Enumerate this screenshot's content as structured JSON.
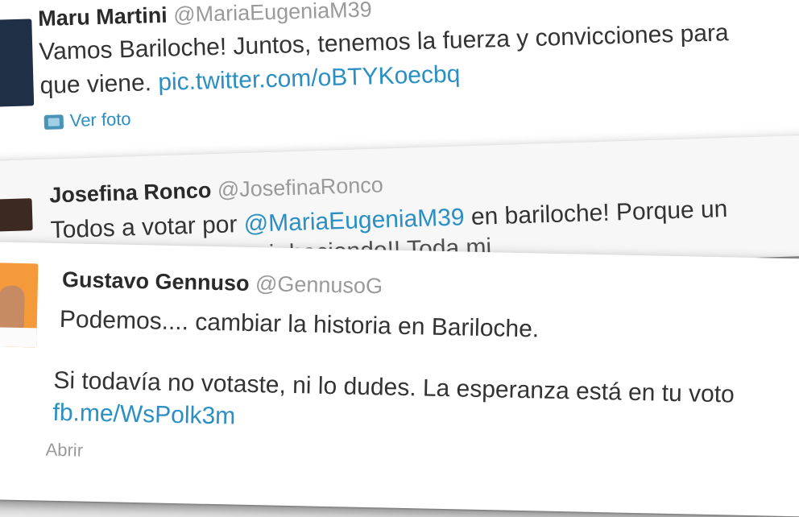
{
  "tweets": [
    {
      "name": "Maru Martini",
      "handle": "@MariaEugeniaM39",
      "line1": "Vamos Bariloche! Juntos, tenemos la fuerza y convicciones para",
      "line2_text": "que viene.",
      "line2_link": "pic.twitter.com/oBTYKoecbq",
      "media_label": "Ver foto"
    },
    {
      "name": "Josefina Ronco",
      "handle": "@JosefinaRonco",
      "line1_prefix": "Todos a votar por",
      "line1_mention": "@MariaEugeniaM39",
      "line1_suffix": "en bariloche! Porque un",
      "line2": "posible!! Elegir seguir haciendo!! Toda mi"
    },
    {
      "name": "Gustavo Gennuso",
      "handle": "@GennusoG",
      "line1": "Podemos.... cambiar la historia en Bariloche.",
      "line2": "Si todavía no votaste, ni lo dudes. La esperanza está en tu voto",
      "link": "fb.me/WsPolk3m",
      "action_label": "Abrir"
    }
  ]
}
